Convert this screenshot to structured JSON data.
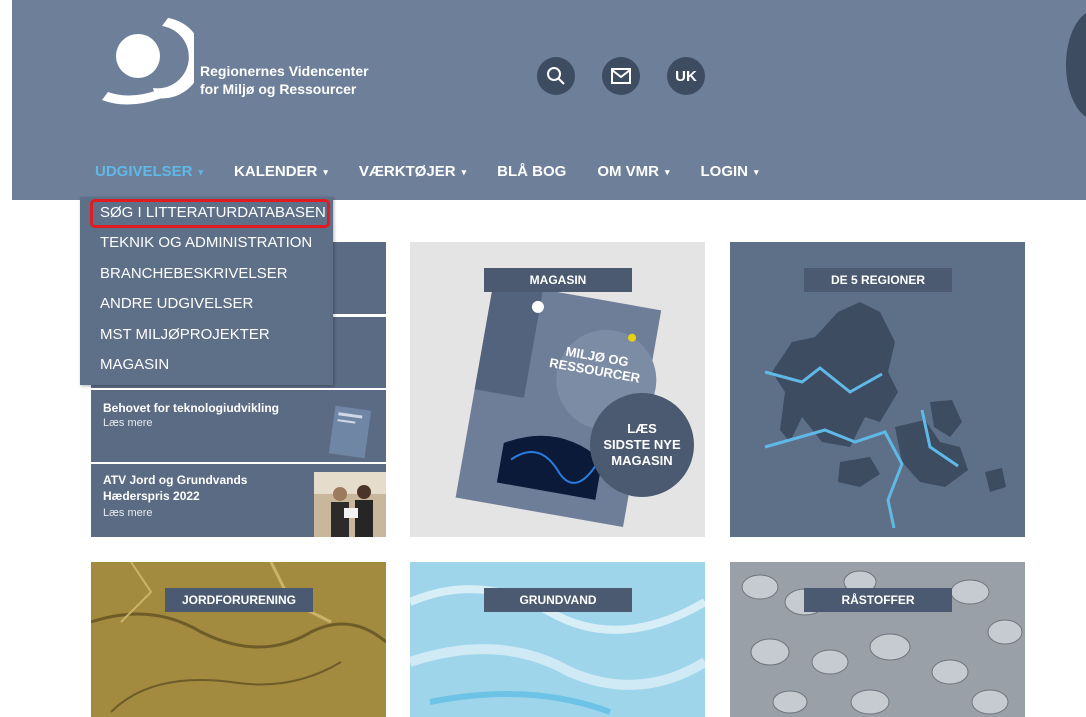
{
  "brand": {
    "line1": "Regionernes Videncenter",
    "line2": "for Miljø og Ressourcer"
  },
  "header_icons": {
    "search": "search-icon",
    "mail": "mail-icon",
    "uk_label": "UK"
  },
  "nav": [
    {
      "label": "UDGIVELSER",
      "caret": "▾"
    },
    {
      "label": "KALENDER",
      "caret": "▾"
    },
    {
      "label": "VÆRKTØJER",
      "caret": "▾"
    },
    {
      "label": "BLÅ BOG",
      "caret": ""
    },
    {
      "label": "OM VMR",
      "caret": "▾"
    },
    {
      "label": "LOGIN",
      "caret": "▾"
    }
  ],
  "dropdown": [
    "SØG I LITTERATURDATABASEN",
    "TEKNIK OG ADMINISTRATION",
    "BRANCHEBESKRIVELSER",
    "ANDRE UDGIVELSER",
    "MST MILJØPROJEKTER",
    "MAGASIN"
  ],
  "news": [
    {
      "title": "Behovet for teknologiudvikling",
      "more": "Læs mere"
    },
    {
      "title": "ATV Jord og Grundvands Hæderspris 2022",
      "title_l1": "ATV Jord og Grundvands",
      "title_l2": "Hæderspris 2022",
      "more": "Læs mere"
    }
  ],
  "tiles": {
    "magasin": {
      "label": "MAGASIN",
      "cover_title_1": "MILJØ OG",
      "cover_title_2": "RESSOURCER",
      "cta": [
        "LÆS",
        "SIDSTE NYE",
        "MAGASIN"
      ]
    },
    "regioner": {
      "label": "DE 5 REGIONER"
    },
    "jord": {
      "label": "JORDFORURENING"
    },
    "grund": {
      "label": "GRUNDVAND"
    },
    "raa": {
      "label": "RÅSTOFFER"
    }
  },
  "colors": {
    "header": "#6e7f99",
    "active_nav": "#5fb9e7",
    "highlight": "#e11b22",
    "tile_label": "#4b5a70"
  }
}
